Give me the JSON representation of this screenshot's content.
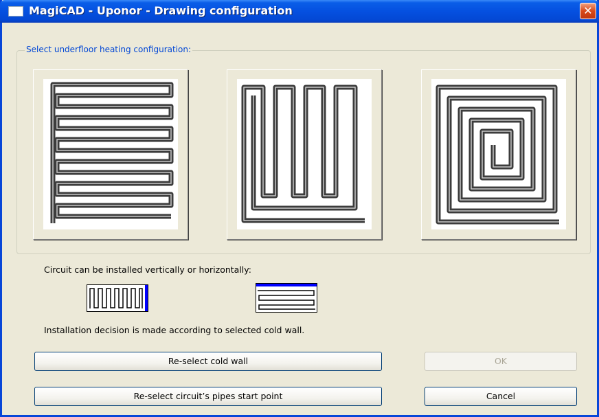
{
  "window": {
    "title": "MagiCAD - Uponor - Drawing configuration",
    "close_glyph": "✕"
  },
  "group": {
    "label": "Select underfloor heating configuration:"
  },
  "patterns": [
    {
      "name": "parallel-serpentine",
      "icon": "serpentine-pattern-icon"
    },
    {
      "name": "meander",
      "icon": "meander-pattern-icon"
    },
    {
      "name": "spiral",
      "icon": "spiral-pattern-icon"
    }
  ],
  "orientation": {
    "label": "Circuit can be installed vertically or horizontally:",
    "vertical_icon": "vertical-circuit-icon",
    "horizontal_icon": "horizontal-circuit-icon"
  },
  "info": {
    "text": "Installation decision is made according to selected cold wall."
  },
  "buttons": {
    "reselect_wall": "Re-select cold wall",
    "reselect_start": "Re-select circuit’s pipes start point",
    "ok": "OK",
    "cancel": "Cancel"
  },
  "colors": {
    "title_bar": "#0550e0",
    "accent_blue": "#0046d5",
    "pipe": "#3c3c3c"
  }
}
